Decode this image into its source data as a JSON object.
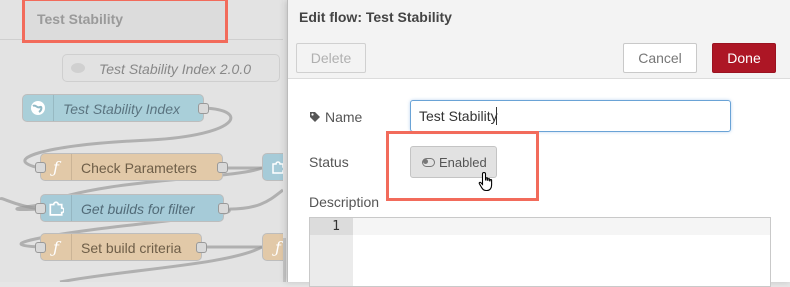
{
  "workspace": {
    "tab_label": "Test Stability",
    "nodes": {
      "comment": "Test Stability Index 2.0.0",
      "link_in": "Test Stability Index",
      "check_params": "Check Parameters",
      "get_builds": "Get builds for filter",
      "set_criteria": "Set build criteria"
    }
  },
  "tray": {
    "title": "Edit flow: Test Stability",
    "delete_label": "Delete",
    "cancel_label": "Cancel",
    "done_label": "Done",
    "name_label": "Name",
    "name_value": "Test Stability",
    "status_label": "Status",
    "status_toggle_label": "Enabled",
    "description_label": "Description",
    "editor_line_numbers": [
      "1"
    ]
  },
  "colors": {
    "accent_done": "#ad1625",
    "highlight": "#f26b5b",
    "function_node": "#e2c9a8",
    "subflow_node": "#a6cbd8"
  },
  "icons": {
    "name": "tag-icon",
    "status": "toggle-icon",
    "cursor": "hand-pointer-icon"
  }
}
